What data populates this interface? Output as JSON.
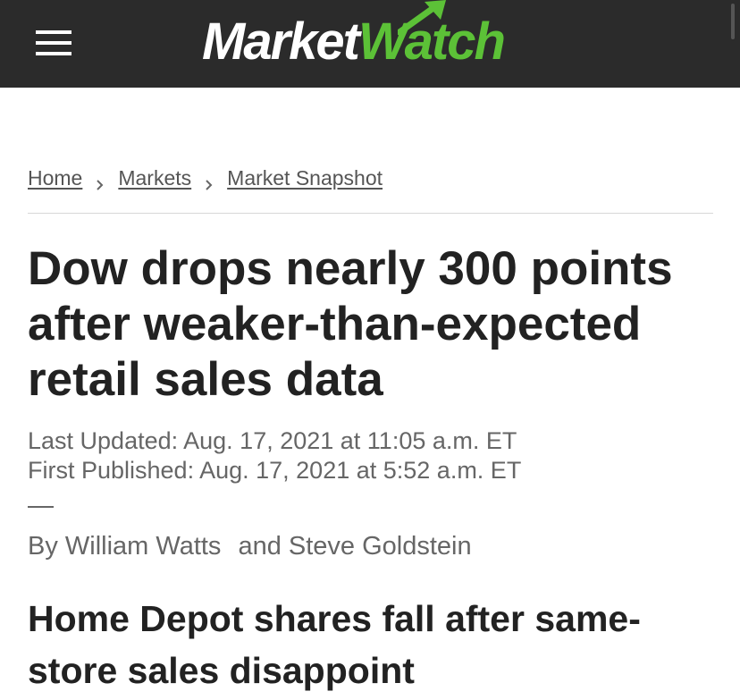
{
  "header": {
    "logo": {
      "part1": "Market",
      "part2": "Watch"
    },
    "colors": {
      "background": "#2b2b2b",
      "brand_green": "#5cc137"
    }
  },
  "breadcrumb": [
    {
      "label": "Home"
    },
    {
      "label": "Markets"
    },
    {
      "label": "Market Snapshot"
    }
  ],
  "article": {
    "headline_lines": [
      "Dow drops nearly 300 points",
      "after weaker-than-expected",
      "retail sales data"
    ],
    "last_updated": "Last Updated: Aug. 17, 2021 at 11:05 a.m. ET",
    "first_published": "First Published: Aug. 17, 2021 at 5:52 a.m. ET",
    "byline": {
      "prefix": "By",
      "author1": "William Watts",
      "conjunction": "and",
      "author2": "Steve Goldstein"
    },
    "subheadline_lines": [
      "Home Depot shares fall after same-",
      "store sales disappoint"
    ]
  }
}
